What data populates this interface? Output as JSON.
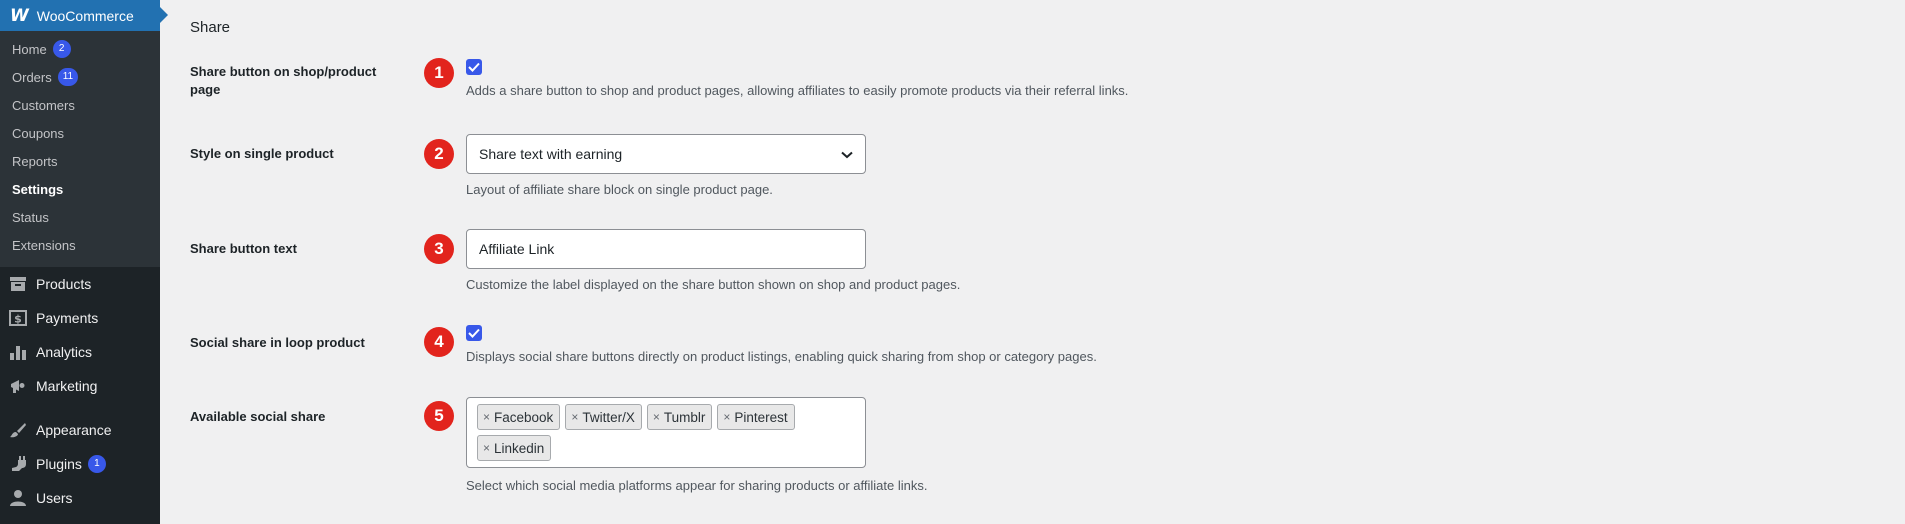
{
  "sidebar": {
    "header": "WooCommerce",
    "sub_items": [
      {
        "label": "Home",
        "badge": "2"
      },
      {
        "label": "Orders",
        "badge": "11"
      },
      {
        "label": "Customers"
      },
      {
        "label": "Coupons"
      },
      {
        "label": "Reports"
      },
      {
        "label": "Settings",
        "active": true
      },
      {
        "label": "Status"
      },
      {
        "label": "Extensions"
      }
    ],
    "main_items": [
      {
        "label": "Products",
        "icon": "archive-icon"
      },
      {
        "label": "Payments",
        "icon": "dollar-icon"
      },
      {
        "label": "Analytics",
        "icon": "bar-chart-icon"
      },
      {
        "label": "Marketing",
        "icon": "megaphone-icon"
      },
      {
        "label": "Appearance",
        "icon": "brush-icon"
      },
      {
        "label": "Plugins",
        "icon": "plug-icon",
        "badge": "1"
      },
      {
        "label": "Users",
        "icon": "user-icon"
      }
    ]
  },
  "section": {
    "title": "Share",
    "rows": [
      {
        "number": "1",
        "label": "Share button on shop/product page",
        "description": "Adds a share button to shop and product pages, allowing affiliates to easily promote products via their referral links."
      },
      {
        "number": "2",
        "label": "Style on single product",
        "select_value": "Share text with earning",
        "description": "Layout of affiliate share block on single product page."
      },
      {
        "number": "3",
        "label": "Share button text",
        "input_value": "Affiliate Link",
        "description": "Customize the label displayed on the share button shown on shop and product pages."
      },
      {
        "number": "4",
        "label": "Social share in loop product",
        "description": "Displays social share buttons directly on product listings, enabling quick sharing from shop or category pages."
      },
      {
        "number": "5",
        "label": "Available social share",
        "tags": [
          "Facebook",
          "Twitter/X",
          "Tumblr",
          "Pinterest",
          "Linkedin"
        ],
        "description": "Select which social media platforms appear for sharing products or affiliate links."
      }
    ]
  },
  "colors": {
    "accent": "#3858e9",
    "marker": "#e2241d",
    "sidebar_bg": "#1d2327",
    "submenu_bg": "#2c3338",
    "header_bg": "#2271b1"
  }
}
